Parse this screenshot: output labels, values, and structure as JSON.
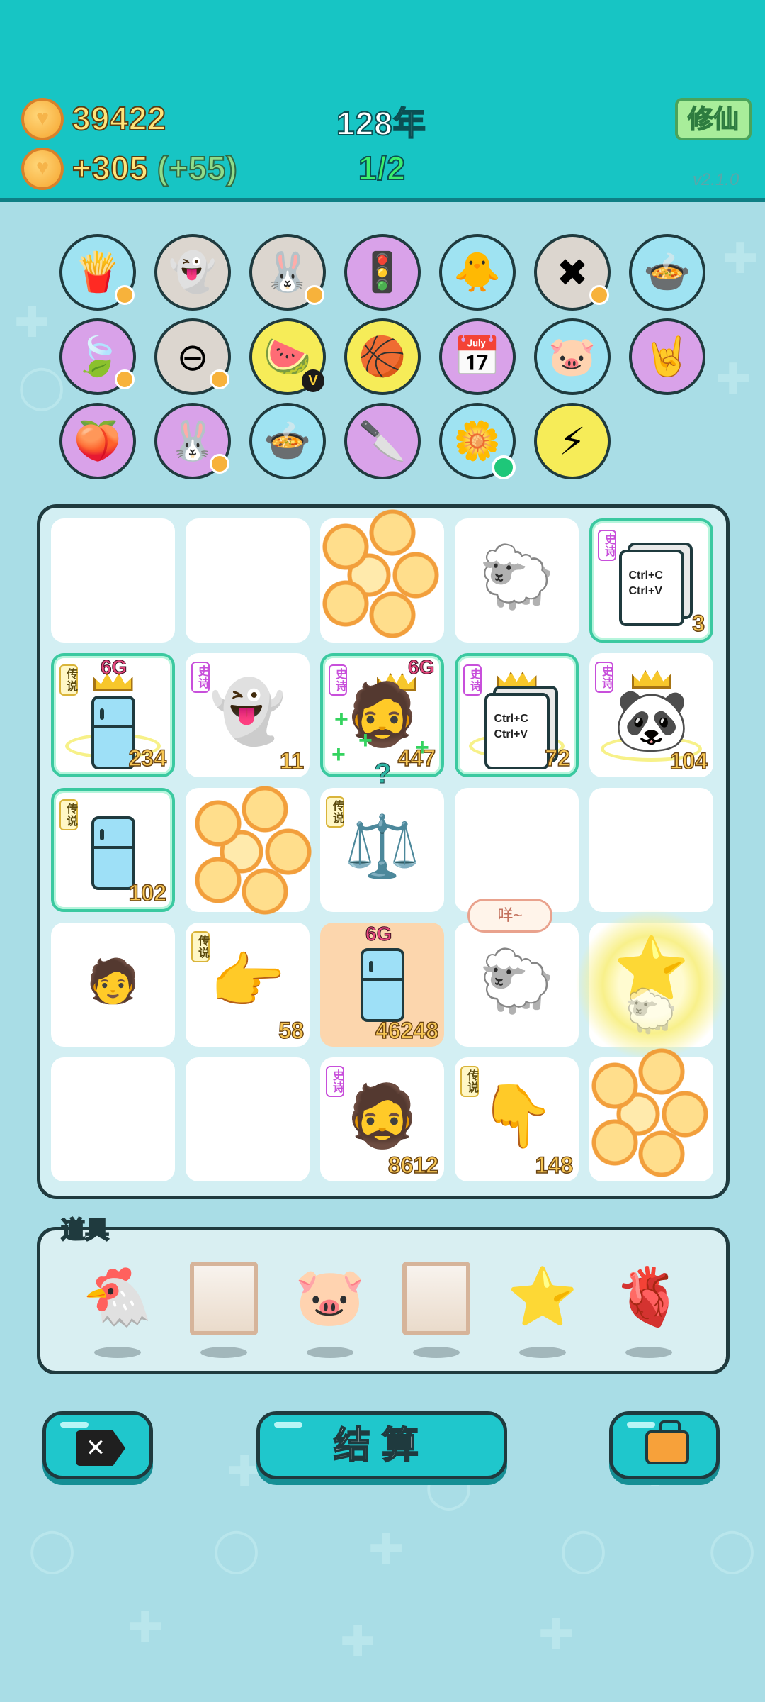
{
  "header": {
    "coins": "39422",
    "income": "+305",
    "bonus": "(+55)",
    "year": "128年",
    "progress": "1/2",
    "xiuxian_label": "修仙",
    "version": "v2.1.0"
  },
  "relics": [
    {
      "name": "fries-icon",
      "bg": "cyan",
      "glyph": "🍟",
      "mark": "coin"
    },
    {
      "name": "ghost-wink-icon",
      "bg": "grey",
      "glyph": "👻",
      "mark": ""
    },
    {
      "name": "bunny-icon",
      "bg": "grey",
      "glyph": "🐰",
      "mark": "coin"
    },
    {
      "name": "traffic-ghost-icon",
      "bg": "lavender",
      "glyph": "🚦",
      "mark": ""
    },
    {
      "name": "chick-egg-icon",
      "bg": "cyan",
      "glyph": "🐥",
      "mark": ""
    },
    {
      "name": "remove-tag-icon",
      "bg": "grey",
      "glyph": "✖",
      "mark": "coin"
    },
    {
      "name": "duck-pot-icon",
      "bg": "cyan",
      "glyph": "🍲",
      "mark": ""
    },
    {
      "name": "leaf-icon",
      "bg": "lavender",
      "glyph": "🍃",
      "mark": "coin"
    },
    {
      "name": "minus-circle-icon",
      "bg": "grey",
      "glyph": "⊖",
      "mark": "coin"
    },
    {
      "name": "fruit-basket-icon",
      "bg": "yellow",
      "glyph": "🍉",
      "mark": "v"
    },
    {
      "name": "basketballs-icon",
      "bg": "yellow",
      "glyph": "🏀",
      "mark": ""
    },
    {
      "name": "calendar-icon",
      "bg": "lavender",
      "glyph": "📅",
      "mark": ""
    },
    {
      "name": "piggy-bank-icon",
      "bg": "cyan",
      "glyph": "🐷",
      "mark": ""
    },
    {
      "name": "rock-hand-icon",
      "bg": "lavender",
      "glyph": "🤘",
      "mark": ""
    },
    {
      "name": "eyepatch-peach-icon",
      "bg": "lavender",
      "glyph": "🍑",
      "mark": ""
    },
    {
      "name": "bunny-icon-2",
      "bg": "lavender",
      "glyph": "🐰",
      "mark": "coin"
    },
    {
      "name": "duck-pot-icon-2",
      "bg": "cyan",
      "glyph": "🍲",
      "mark": ""
    },
    {
      "name": "cleaver-icon",
      "bg": "lavender",
      "glyph": "🔪",
      "mark": ""
    },
    {
      "name": "potted-flower-icon",
      "bg": "cyan",
      "glyph": "🌼",
      "mark": "dot"
    },
    {
      "name": "lightning-icon",
      "bg": "yellow",
      "glyph": "⚡",
      "mark": ""
    }
  ],
  "board": {
    "tags": {
      "epic": "史诗",
      "legend": "传说"
    },
    "six_g": "6G",
    "copy_text": "Ctrl+C\nCtrl+V",
    "bubble": "咩~",
    "qmark": "?",
    "numbers": {
      "c04": "3",
      "c10": "234",
      "c11": "11",
      "c12": "447",
      "c13": "72",
      "c14": "104",
      "c20": "102",
      "c31": "58",
      "c32": "46248",
      "c42": "8612",
      "c43": "148"
    }
  },
  "items": {
    "label": "道具",
    "list": [
      "chicken-icon",
      "empty-frame",
      "piggy-bank-icon",
      "empty-frame",
      "star-icon",
      "liver-icon"
    ]
  },
  "buttons": {
    "settle_label": "结算"
  }
}
